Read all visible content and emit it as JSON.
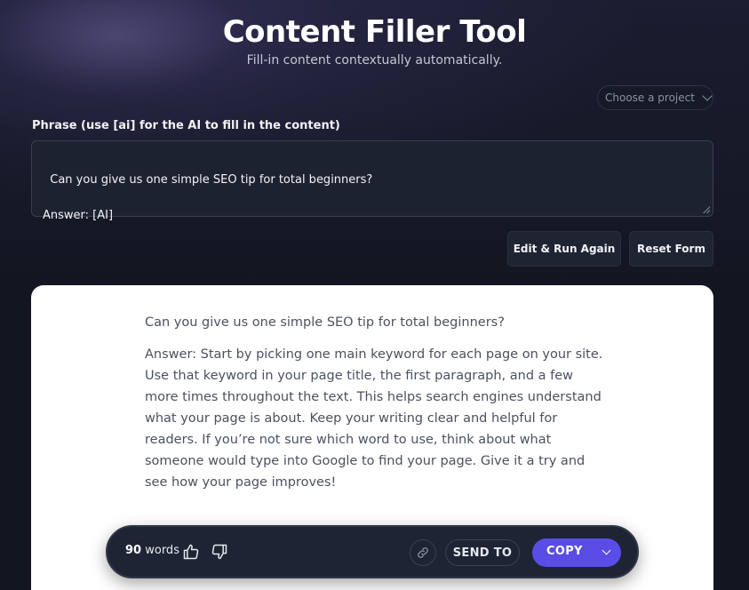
{
  "header": {
    "title": "Content Filler Tool",
    "subtitle": "Fill-in content contextually automatically."
  },
  "project_select": {
    "placeholder": "Choose a project"
  },
  "phrase": {
    "label": "Phrase (use [ai] for the AI to fill in the content)",
    "value": "Can you give us one simple SEO tip for total beginners?\n\nAnswer: [AI]"
  },
  "actions": {
    "edit_run_again": "Edit & Run Again",
    "reset_form": "Reset Form"
  },
  "result": {
    "paragraphs": [
      "Can you give us one simple SEO tip for total beginners?",
      "Answer: Start by picking one main keyword for each page on your site. Use that keyword in your page title, the first paragraph, and a few more times throughout the text. This helps search engines understand what your page is about. Keep your writing clear and helpful for readers. If you’re not sure which word to use, think about what someone would type into Google to find your page. Give it a try and see how your page improves!"
    ]
  },
  "toolbar": {
    "word_count": "90",
    "word_label": "words",
    "send_to": "SEND TO",
    "copy": "COPY"
  },
  "colors": {
    "background": "#131621",
    "accent": "#5a4de6",
    "card": "#ffffff"
  },
  "icons": [
    "thumbs-up-icon",
    "thumbs-down-icon",
    "link-icon",
    "chevron-down-icon"
  ]
}
